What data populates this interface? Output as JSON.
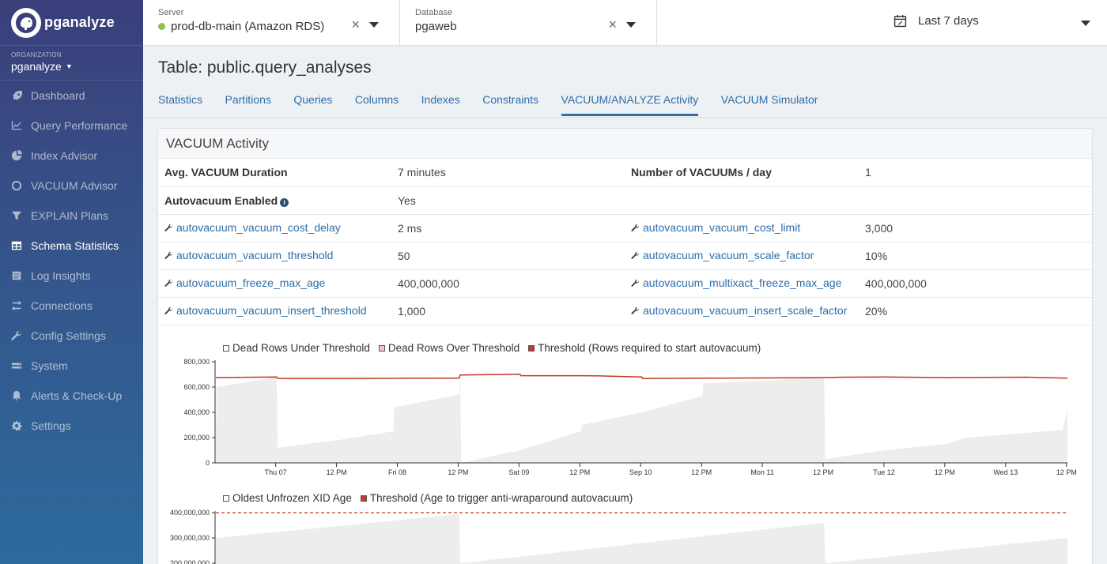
{
  "brand": {
    "name": "pganalyze"
  },
  "org": {
    "label": "ORGANIZATION",
    "name": "pganalyze"
  },
  "nav": [
    {
      "label": "Dashboard",
      "icon": "rocket-icon"
    },
    {
      "label": "Query Performance",
      "icon": "line-chart-icon"
    },
    {
      "label": "Index Advisor",
      "icon": "index-icon"
    },
    {
      "label": "VACUUM Advisor",
      "icon": "circle-icon"
    },
    {
      "label": "EXPLAIN Plans",
      "icon": "filter-icon"
    },
    {
      "label": "Schema Statistics",
      "icon": "table-icon"
    },
    {
      "label": "Log Insights",
      "icon": "log-icon"
    },
    {
      "label": "Connections",
      "icon": "exchange-icon"
    },
    {
      "label": "Config Settings",
      "icon": "wrench-icon"
    },
    {
      "label": "System",
      "icon": "server-icon"
    },
    {
      "label": "Alerts & Check-Up",
      "icon": "bell-icon"
    },
    {
      "label": "Settings",
      "icon": "gear-icon"
    }
  ],
  "active_nav": "Schema Statistics",
  "topbar": {
    "server_label": "Server",
    "server_value": "prod-db-main (Amazon RDS)",
    "server_status_color": "#8bc34a",
    "database_label": "Database",
    "database_value": "pgaweb",
    "date_range": "Last 7 days"
  },
  "page": {
    "title": "Table: public.query_analyses"
  },
  "tabs": [
    "Statistics",
    "Partitions",
    "Queries",
    "Columns",
    "Indexes",
    "Constraints",
    "VACUUM/ANALYZE Activity",
    "VACUUM Simulator"
  ],
  "active_tab": "VACUUM/ANALYZE Activity",
  "panel": {
    "title": "VACUUM Activity",
    "rows": [
      {
        "k1": "Avg. VACUUM Duration",
        "v1": "7 minutes",
        "k2": "Number of VACUUMs / day",
        "v2": "1",
        "link": false
      },
      {
        "k1": "Autovacuum Enabled",
        "v1": "Yes",
        "k2": "",
        "v2": "",
        "link": false,
        "info": true
      },
      {
        "k1": "autovacuum_vacuum_cost_delay",
        "v1": "2 ms",
        "k2": "autovacuum_vacuum_cost_limit",
        "v2": "3,000",
        "link": true
      },
      {
        "k1": "autovacuum_vacuum_threshold",
        "v1": "50",
        "k2": "autovacuum_vacuum_scale_factor",
        "v2": "10%",
        "link": true
      },
      {
        "k1": "autovacuum_freeze_max_age",
        "v1": "400,000,000",
        "k2": "autovacuum_multixact_freeze_max_age",
        "v2": "400,000,000",
        "link": true
      },
      {
        "k1": "autovacuum_vacuum_insert_threshold",
        "v1": "1,000",
        "k2": "autovacuum_vacuum_insert_scale_factor",
        "v2": "20%",
        "link": true
      }
    ]
  },
  "chart_data": [
    {
      "type": "area",
      "legend": [
        "Dead Rows Under Threshold",
        "Dead Rows Over Threshold",
        "Threshold (Rows required to start autovacuum)"
      ],
      "colors": {
        "under": "#ededed",
        "over": "#f4c7c7",
        "threshold": "#c23b22"
      },
      "ylim": [
        0,
        800000
      ],
      "yticks": [
        "0",
        "200,000",
        "400,000",
        "600,000",
        "800,000"
      ],
      "yvals": [
        0,
        200000,
        400000,
        600000,
        800000
      ],
      "xticks": [
        "Thu 07",
        "12 PM",
        "Fri 08",
        "12 PM",
        "Sat 09",
        "12 PM",
        "Sep 10",
        "12 PM",
        "Mon 11",
        "12 PM",
        "Tue 12",
        "12 PM",
        "Wed 13",
        "12 PM"
      ],
      "x_hours": [
        0,
        168
      ],
      "xtick_hours": [
        0,
        12,
        24,
        36,
        48,
        60,
        72,
        84,
        96,
        108,
        120,
        132,
        144,
        156
      ],
      "xstart_hour": -4,
      "threshold": [
        [
          -4,
          675000
        ],
        [
          8,
          680000
        ],
        [
          8.2,
          668000
        ],
        [
          24,
          668000
        ],
        [
          36,
          670000
        ],
        [
          44,
          670000
        ],
        [
          44.2,
          695000
        ],
        [
          56,
          702000
        ],
        [
          56.2,
          690000
        ],
        [
          68,
          690000
        ],
        [
          72,
          688000
        ],
        [
          80,
          680000
        ],
        [
          80.2,
          668000
        ],
        [
          92,
          670000
        ],
        [
          104,
          672000
        ],
        [
          116,
          675000
        ],
        [
          120,
          678000
        ],
        [
          128,
          680000
        ],
        [
          140,
          675000
        ],
        [
          156,
          678000
        ],
        [
          164,
          670000
        ]
      ],
      "dead_under": [
        [
          -4,
          0
        ],
        [
          -3.9,
          600000
        ],
        [
          8,
          680000
        ],
        [
          8.2,
          120000
        ],
        [
          20,
          180000
        ],
        [
          31,
          250000
        ],
        [
          31.2,
          440000
        ],
        [
          44,
          540000
        ],
        [
          44.2,
          690000
        ],
        [
          44.4,
          0
        ],
        [
          56,
          100000
        ],
        [
          68,
          250000
        ],
        [
          68.2,
          300000
        ],
        [
          80,
          400000
        ],
        [
          92,
          530000
        ],
        [
          92.2,
          630000
        ],
        [
          104,
          650000
        ],
        [
          116,
          680000
        ],
        [
          116.2,
          30000
        ],
        [
          128,
          100000
        ],
        [
          140,
          150000
        ],
        [
          144,
          200000
        ],
        [
          163,
          260000
        ],
        [
          164,
          420000
        ],
        [
          164,
          0
        ]
      ]
    },
    {
      "type": "area",
      "legend": [
        "Oldest Unfrozen XID Age",
        "Threshold (Age to trigger anti-wraparound autovacuum)"
      ],
      "colors": {
        "age": "#ededed",
        "threshold": "#c23b22"
      },
      "ylim": [
        200000000,
        400000000
      ],
      "yticks": [
        "200,000,000",
        "300,000,000",
        "400,000,000"
      ],
      "yvals": [
        200000000,
        300000000,
        400000000
      ],
      "threshold_value": 400000000,
      "xstart_hour": -4,
      "age": [
        [
          -4,
          300000000
        ],
        [
          44,
          425000000
        ],
        [
          44.2,
          200000000
        ],
        [
          116,
          360000000
        ],
        [
          116.2,
          200000000
        ],
        [
          164,
          300000000
        ]
      ]
    }
  ]
}
